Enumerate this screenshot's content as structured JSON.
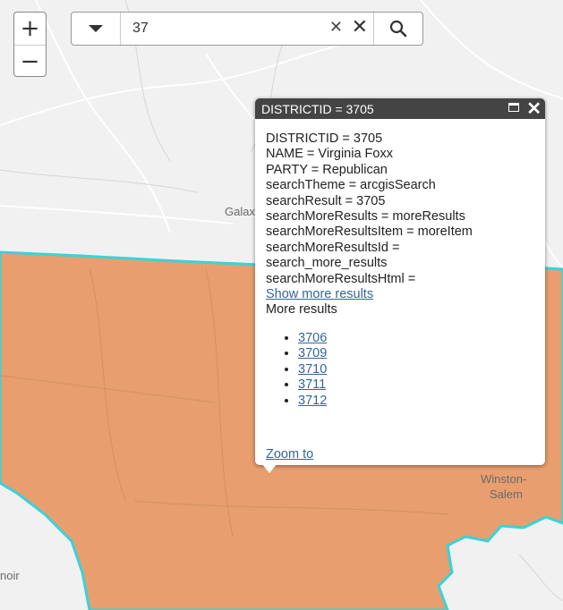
{
  "map": {
    "district_fill": "#e89e6e",
    "district_border": "#37d4d8",
    "labels": {
      "galax": "Galax",
      "winston": "Winston-",
      "salem": "Salem",
      "lenoir": "noir"
    }
  },
  "zoom": {
    "in": "+",
    "out": "−"
  },
  "search": {
    "value": "37",
    "clear_small": "✕",
    "clear_large": "✕"
  },
  "popup": {
    "title": "DISTRICTID = 3705",
    "lines": [
      "DISTRICTID = 3705",
      "NAME = Virginia Foxx",
      "PARTY = Republican",
      "searchTheme = arcgisSearch",
      "searchResult = 3705",
      "searchMoreResults = moreResults",
      "searchMoreResultsItem = moreItem",
      "searchMoreResultsId =",
      "search_more_results",
      "searchMoreResultsHtml ="
    ],
    "show_more": "Show more results",
    "more_results_label": "More results",
    "results": [
      "3706",
      "3709",
      "3710",
      "3711",
      "3712"
    ],
    "zoom_to": "Zoom to"
  }
}
